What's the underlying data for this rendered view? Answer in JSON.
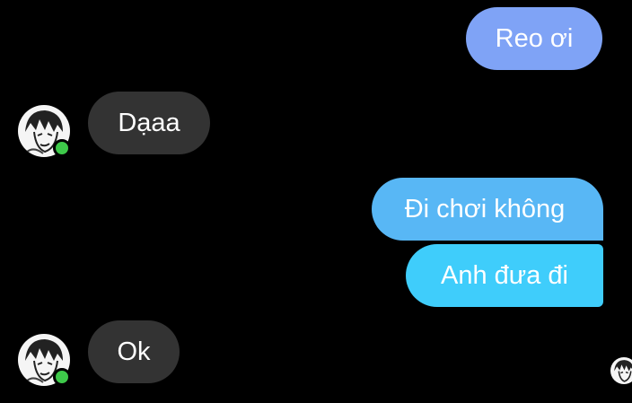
{
  "messages": [
    {
      "id": "msg-1",
      "direction": "sent",
      "text": "Reo ơi",
      "color": "#7fa3f6"
    },
    {
      "id": "msg-2",
      "direction": "received",
      "text": "Dạaa",
      "color": "#333333"
    },
    {
      "id": "msg-3",
      "direction": "sent",
      "text": "Đi chơi không",
      "color": "#58b7f5"
    },
    {
      "id": "msg-4",
      "direction": "sent",
      "text": "Anh đưa đi",
      "color": "#3fcdfb"
    },
    {
      "id": "msg-5",
      "direction": "received",
      "text": "Ok",
      "color": "#333333"
    }
  ],
  "contact": {
    "online": true,
    "online_color": "#3ec94a",
    "avatar_icon": "manga-character-avatar-icon"
  },
  "seen_indicator": {
    "icon": "seen-avatar-icon"
  }
}
